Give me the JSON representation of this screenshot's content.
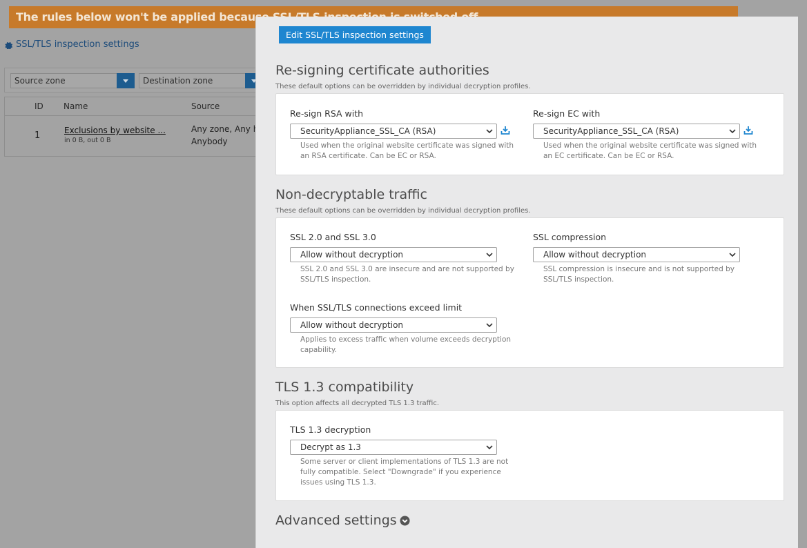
{
  "background": {
    "banner_text": "The rules below won't be applied because SSL/TLS inspection is switched off",
    "settings_link": "SSL/TLS inspection settings",
    "filters": {
      "source_zone": "Source zone",
      "destination_zone": "Destination zone"
    },
    "table": {
      "headers": [
        "ID",
        "Name",
        "Source"
      ],
      "rows": [
        {
          "id": "1",
          "name": "Exclusions by website ...",
          "traffic": "in 0 B, out 0 B",
          "source_line1": "Any zone, Any h",
          "source_line2": "Anybody"
        }
      ]
    }
  },
  "modal": {
    "edit_button": "Edit SSL/TLS inspection settings",
    "resign": {
      "title": "Re-signing certificate authorities",
      "subtitle": "These default options can be overridden by individual decryption profiles.",
      "rsa": {
        "label": "Re-sign RSA with",
        "value": "SecurityAppliance_SSL_CA (RSA)",
        "help": "Used when the original website certificate was signed with an RSA certificate. Can be EC or RSA."
      },
      "ec": {
        "label": "Re-sign EC with",
        "value": "SecurityAppliance_SSL_CA (RSA)",
        "help": "Used when the original website certificate was signed with an EC certificate. Can be EC or RSA."
      }
    },
    "nondecrypt": {
      "title": "Non-decryptable traffic",
      "subtitle": "These default options can be overridden by individual decryption profiles.",
      "ssl_legacy": {
        "label": "SSL 2.0 and SSL 3.0",
        "value": "Allow without decryption",
        "help": "SSL 2.0 and SSL 3.0 are insecure and are not supported by SSL/TLS inspection."
      },
      "compression": {
        "label": "SSL compression",
        "value": "Allow without decryption",
        "help": "SSL compression is insecure and is not supported by SSL/TLS inspection."
      },
      "limit": {
        "label": "When SSL/TLS connections exceed limit",
        "value": "Allow without decryption",
        "help": "Applies to excess traffic when volume exceeds decryption capability."
      }
    },
    "tls13": {
      "title": "TLS 1.3 compatibility",
      "subtitle": "This option affects all decrypted TLS 1.3 traffic.",
      "decryption": {
        "label": "TLS 1.3 decryption",
        "value": "Decrypt as 1.3",
        "help": "Some server or client implementations of TLS 1.3 are not fully compatible. Select \"Downgrade\" if you experience issues using TLS 1.3."
      }
    },
    "advanced": "Advanced settings"
  },
  "colors": {
    "accent": "#1e86d0",
    "banner": "#c77a2a"
  },
  "icons": [
    "gear-icon",
    "chevron-down-icon",
    "download-icon",
    "expand-circle-icon"
  ]
}
